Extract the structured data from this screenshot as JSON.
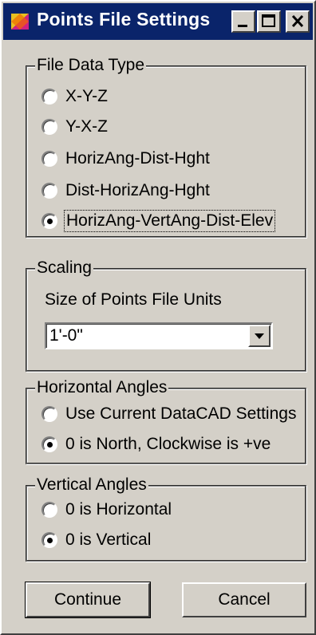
{
  "window": {
    "title": "Points File Settings",
    "icon": "app-icon",
    "controls": [
      "minimize-icon",
      "maximize-icon",
      "close-icon"
    ],
    "titlebar_color": "#0a246a"
  },
  "file_data_type": {
    "legend": "File Data Type",
    "options": [
      {
        "label": "X-Y-Z",
        "checked": false
      },
      {
        "label": "Y-X-Z",
        "checked": false
      },
      {
        "label": "HorizAng-Dist-Hght",
        "checked": false
      },
      {
        "label": "Dist-HorizAng-Hght",
        "checked": false
      },
      {
        "label": "HorizAng-VertAng-Dist-Elev",
        "checked": true
      }
    ]
  },
  "scaling": {
    "legend": "Scaling",
    "label": "Size of Points File Units",
    "value": "1'-0\""
  },
  "horizontal_angles": {
    "legend": "Horizontal Angles",
    "options": [
      {
        "label": "Use Current DataCAD Settings",
        "checked": false
      },
      {
        "label": "0 is North, Clockwise is +ve",
        "checked": true
      }
    ]
  },
  "vertical_angles": {
    "legend": "Vertical Angles",
    "options": [
      {
        "label": "0 is Horizontal",
        "checked": false
      },
      {
        "label": "0 is Vertical",
        "checked": true
      }
    ]
  },
  "buttons": {
    "continue": "Continue",
    "cancel": "Cancel"
  }
}
